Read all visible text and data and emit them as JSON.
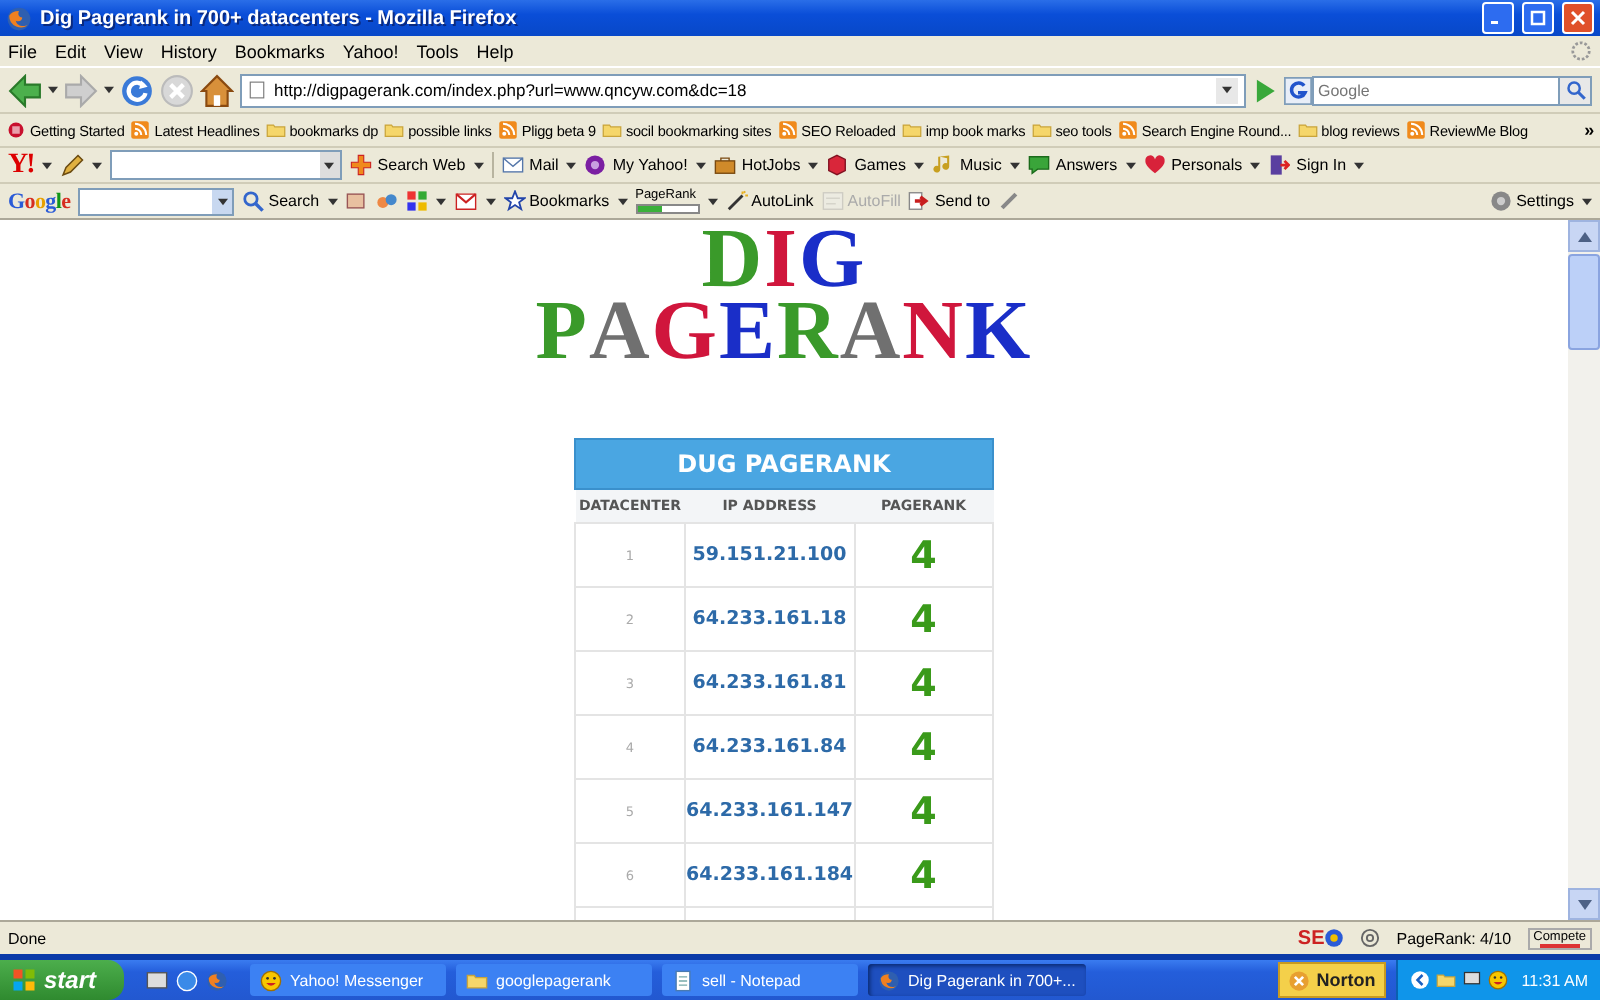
{
  "window": {
    "title": "Dig Pagerank in 700+ datacenters - Mozilla Firefox"
  },
  "menu": [
    "File",
    "Edit",
    "View",
    "History",
    "Bookmarks",
    "Yahoo!",
    "Tools",
    "Help"
  ],
  "nav": {
    "address": "http://digpagerank.com/index.php?url=www.qncyw.com&dc=18",
    "search_placeholder": "Google"
  },
  "bookmarks": {
    "items": [
      {
        "label": "Getting Started",
        "kind": "page"
      },
      {
        "label": "Latest Headlines",
        "kind": "feed"
      },
      {
        "label": "bookmarks dp",
        "kind": "folder"
      },
      {
        "label": "possible links",
        "kind": "folder"
      },
      {
        "label": "Pligg beta 9",
        "kind": "feed"
      },
      {
        "label": "socil bookmarking sites",
        "kind": "folder"
      },
      {
        "label": "SEO Reloaded",
        "kind": "feed"
      },
      {
        "label": "imp book marks",
        "kind": "folder"
      },
      {
        "label": "seo tools",
        "kind": "folder"
      },
      {
        "label": "Search Engine Round...",
        "kind": "feed"
      },
      {
        "label": "blog reviews",
        "kind": "folder"
      },
      {
        "label": "ReviewMe Blog",
        "kind": "feed"
      }
    ],
    "overflow": "»"
  },
  "yahoo_toolbar": {
    "logo": "Y!",
    "items": [
      {
        "label": "Search Web",
        "kind": "plus"
      },
      {
        "label": "Mail",
        "kind": "mail"
      },
      {
        "label": "My Yahoo!",
        "kind": "circle"
      },
      {
        "label": "HotJobs",
        "kind": "briefcase"
      },
      {
        "label": "Games",
        "kind": "cube"
      },
      {
        "label": "Music",
        "kind": "note"
      },
      {
        "label": "Answers",
        "kind": "bubble"
      },
      {
        "label": "Personals",
        "kind": "heart"
      },
      {
        "label": "Sign In",
        "kind": "door"
      }
    ]
  },
  "google_toolbar": {
    "logo": "Google",
    "items": [
      {
        "label": "Search",
        "kind": "search",
        "disabled": false
      },
      {
        "label": "Bookmarks",
        "kind": "star",
        "disabled": false
      },
      {
        "label": "PageRank",
        "kind": "meter",
        "level": 0.4,
        "disabled": false
      },
      {
        "label": "AutoLink",
        "kind": "wand",
        "disabled": false
      },
      {
        "label": "AutoFill",
        "kind": "form",
        "disabled": true
      },
      {
        "label": "Send to",
        "kind": "send",
        "disabled": false
      }
    ],
    "settings": "Settings"
  },
  "logo": {
    "lines": [
      [
        {
          "char": "D",
          "color": "#3a9a2a"
        },
        {
          "char": "I",
          "color": "#d0163c"
        },
        {
          "char": "G",
          "color": "#1a2ec8"
        }
      ],
      [
        {
          "char": "P",
          "color": "#3a9a2a"
        },
        {
          "char": "A",
          "color": "#707070"
        },
        {
          "char": "G",
          "color": "#d0163c"
        },
        {
          "char": "E",
          "color": "#1a2ec8"
        },
        {
          "char": "R",
          "color": "#3a9a2a"
        },
        {
          "char": "A",
          "color": "#707070"
        },
        {
          "char": "N",
          "color": "#d0163c"
        },
        {
          "char": "K",
          "color": "#1a2ec8"
        }
      ]
    ]
  },
  "table": {
    "title": "DUG PAGERANK",
    "columns": [
      "DATACENTER",
      "IP ADDRESS",
      "PAGERANK"
    ],
    "rows": [
      [
        "1",
        "59.151.21.100",
        "4"
      ],
      [
        "2",
        "64.233.161.18",
        "4"
      ],
      [
        "3",
        "64.233.161.81",
        "4"
      ],
      [
        "4",
        "64.233.161.84",
        "4"
      ],
      [
        "5",
        "64.233.161.147",
        "4"
      ],
      [
        "6",
        "64.233.161.184",
        "4"
      ]
    ]
  },
  "status_bar": {
    "text": "Done",
    "seo": "SE",
    "pagerank": "PageRank: 4/10",
    "compete": "Compete"
  },
  "taskbar": {
    "start": "start",
    "tasks": [
      {
        "label": "Yahoo! Messenger",
        "kind": "messenger",
        "selected": false
      },
      {
        "label": "googlepagerank",
        "kind": "folder",
        "selected": false
      },
      {
        "label": "sell - Notepad",
        "kind": "notepad",
        "selected": false
      },
      {
        "label": "Dig Pagerank in 700+...",
        "kind": "firefox",
        "selected": true
      }
    ],
    "norton": "Norton",
    "clock": "11:31 AM"
  }
}
